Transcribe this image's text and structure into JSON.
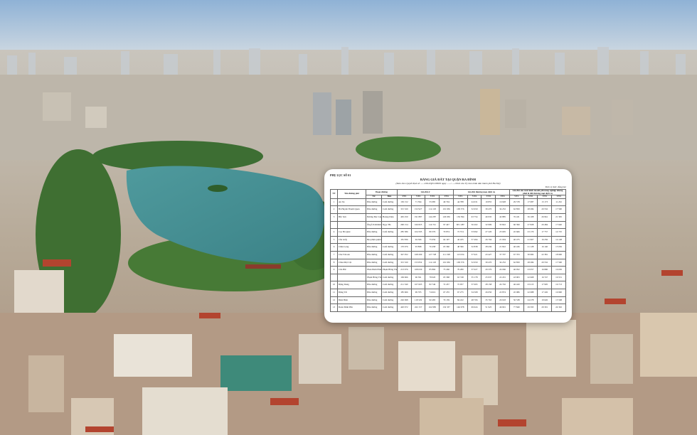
{
  "document": {
    "appendix": "PHỤ LỤC SỐ 01",
    "title": "BẢNG GIÁ ĐẤT TẠI QUẬN BA ĐÌNH",
    "subtitle": "(Kèm theo Quyết định số ....../2024/QĐ-UBND ngày ....../....../2024 của Ủy ban nhân dân thành phố Hà Nội)",
    "unit": "Đơn vị tính: đồng/m2",
    "headers": {
      "stt": "TT",
      "street": "Tên đường phố",
      "segment": "Đoạn đường",
      "from": "Từ",
      "to": "Đến",
      "g1": "Giá đất ở",
      "g2": "Giá đất thương mại, dịch vụ",
      "g3": "Giá đất sản xuất kinh doanh phi nông nghiệp không phải là đất thương mại dịch vụ",
      "positions": [
        "VT1",
        "VT2",
        "VT3",
        "VT4"
      ]
    },
    "rows": [
      {
        "no": "1",
        "name": "An Xá",
        "from": "Đầu đường",
        "to": "Cuối đường",
        "v": [
          "130 152",
          "71 594",
          "55 085",
          "49 704",
          "44 788",
          "24 631",
          "19 855",
          "16 928",
          "29 578",
          "17 087",
          "13 173",
          "11 232"
        ]
      },
      {
        "no": "2",
        "name": "Bà Huyện Thanh Quan",
        "from": "Đầu đường",
        "to": "Cuối đường",
        "v": [
          "315 520",
          "152 927",
          "114 118",
          "101 936",
          "109 576",
          "52 650",
          "39 470",
          "34 252",
          "62 859",
          "28 284",
          "20 532",
          "17 590"
        ]
      },
      {
        "no": "3",
        "name": "Bắc Sơn",
        "from": "Đường Độc Lập",
        "to": "Hoàng Diệu",
        "v": [
          "465 250",
          "191 887",
          "144 287",
          "126 936",
          "136 394",
          "63 754",
          "46 935",
          "42 885",
          "76 431",
          "36 108",
          "26 961",
          "21 395"
        ]
      },
      {
        "no": "",
        "name": "",
        "from": "Ông Ích Khiêm",
        "to": "Ngọc Hà",
        "v": [
          "290 154",
          "166 825",
          "114 741",
          "97 447",
          "68 1 687",
          "56 202",
          "32 999",
          "33 822",
          "60 390",
          "27 828",
          "20 484",
          "17 640"
        ]
      },
      {
        "no": "4",
        "name": "Cao Bá Quát",
        "from": "Đầu đường",
        "to": "Cuối đường",
        "v": [
          "285 386",
          "104 595",
          "80 376",
          "70 874",
          "72 574",
          "33 992",
          "27 220",
          "23 005",
          "45 666",
          "23 170",
          "17 757",
          "14 725"
        ]
      },
      {
        "no": "5",
        "name": "Cầu Giấy",
        "from": "Địa phận quận Ba Đình",
        "to": "",
        "v": [
          "181 836",
          "94 366",
          "75 656",
          "64 197",
          "42 435",
          "57 494",
          "26 794",
          "21 004",
          "40 475",
          "21 967",
          "16 256",
          "14 148"
        ]
      },
      {
        "no": "6",
        "name": "Châu Long",
        "from": "Đầu đường",
        "to": "Cuối đường",
        "v": [
          "170 976",
          "93 898",
          "76 458",
          "63 360",
          "48 396",
          "32 838",
          "28 436",
          "21 822",
          "40 436",
          "21 128",
          "16 140",
          "15 036"
        ]
      },
      {
        "no": "7",
        "name": "Chu Văn An",
        "from": "Đầu đường",
        "to": "Cuối đường",
        "v": [
          "347 052",
          "168 290",
          "127 728",
          "111 198",
          "113 034",
          "57 921",
          "43 427",
          "37 707",
          "67 703",
          "30 982",
          "22 381",
          "18 900"
        ]
      },
      {
        "no": "8",
        "name": "Chùa Một Cột",
        "from": "Đầu đường",
        "to": "Cuối đường",
        "v": [
          "315 520",
          "153 832",
          "114 118",
          "101 936",
          "109 576",
          "52 650",
          "39 470",
          "34 252",
          "62 859",
          "28 284",
          "20 532",
          "17 590"
        ]
      },
      {
        "no": "9",
        "name": "Cửa Bắc",
        "from": "Phan Đình Phùng",
        "to": "Phạm Hồng Thái",
        "v": [
          "213 976",
          "108 630",
          "85 866",
          "75 260",
          "79 280",
          "37 027",
          "29 379",
          "24 066",
          "46 952",
          "23 057",
          "16 890",
          "16 650"
        ]
      },
      {
        "no": "",
        "name": "",
        "from": "Phạm Hồng Thái",
        "to": "Cuối đường",
        "v": [
          "169 966",
          "96 391",
          "78 020",
          "65 368",
          "63 748",
          "35 178",
          "25 937",
          "22 201",
          "43 903",
          "22 668",
          "16 747",
          "16 531"
        ]
      },
      {
        "no": "10",
        "name": "Đặng Dung",
        "from": "Đầu đường",
        "to": "Cuối đường",
        "v": [
          "211 540",
          "107 605",
          "82 746",
          "72 457",
          "72 957",
          "37 695",
          "28 158",
          "24 702",
          "46 420",
          "23 215",
          "17 905",
          "16 713"
        ]
      },
      {
        "no": "11",
        "name": "Đặng Tất",
        "from": "Đầu đường",
        "to": "Cuối đường",
        "v": [
          "185 966",
          "99 705",
          "74 616",
          "67 255",
          "67 275",
          "34 568",
          "26 050",
          "22 874",
          "45 086",
          "22 688",
          "17 226",
          "16 990"
        ]
      },
      {
        "no": "12",
        "name": "Điện Biên",
        "from": "Đầu đường",
        "to": "Cuối đường",
        "v": [
          "226 698",
          "118 529",
          "90 483",
          "79 139",
          "84 432",
          "48 706",
          "35 763",
          "26 918",
          "50 538",
          "24 278",
          "19 626",
          "15 568"
        ]
      },
      {
        "no": "13",
        "name": "Đoàn Đình Phù",
        "from": "Đầu đường",
        "to": "Cuối đường",
        "v": [
          "420 972",
          "222 157",
          "162 985",
          "132 337",
          "146 978",
          "69 624",
          "51 925",
          "46 991",
          "77 849",
          "29 595",
          "29 301",
          "24 302"
        ]
      }
    ]
  }
}
